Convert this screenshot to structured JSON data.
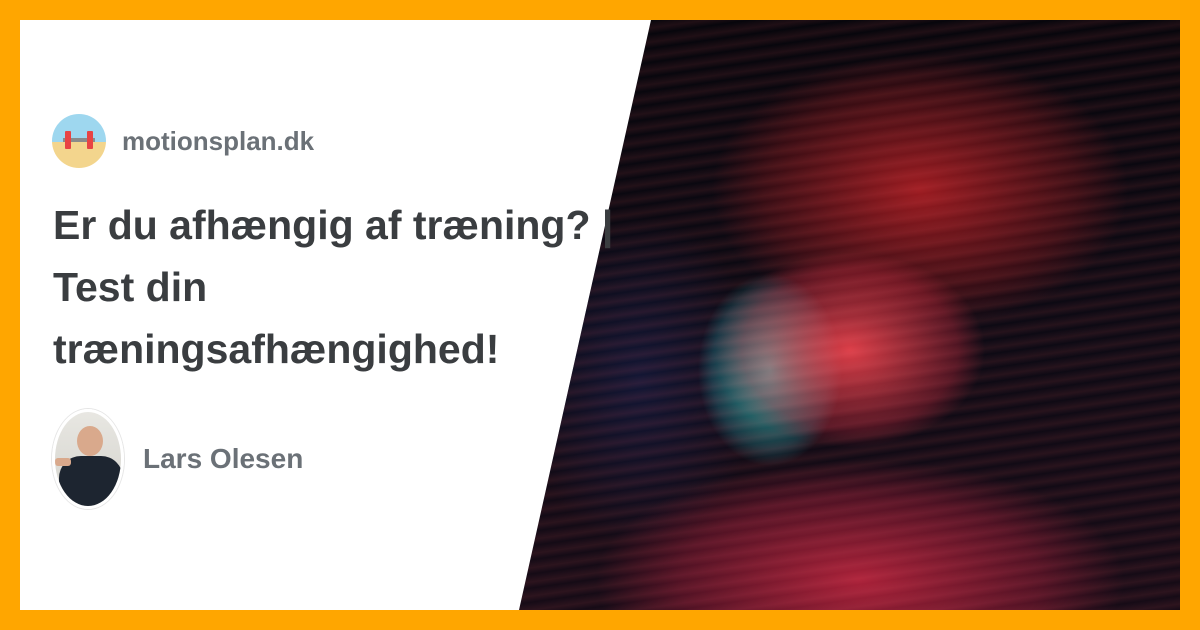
{
  "site": {
    "name": "motionsplan.dk",
    "logo_icon": "barbell-beach-icon"
  },
  "article": {
    "title_line1": "Er du afhængig af træning? |",
    "title_line2": "Test din",
    "title_line3": "træningsafhængighed!"
  },
  "author": {
    "name": "Lars Olesen"
  },
  "colors": {
    "frame": "#FFA600",
    "text_primary": "#3a3d40",
    "text_muted": "#6b7177"
  }
}
